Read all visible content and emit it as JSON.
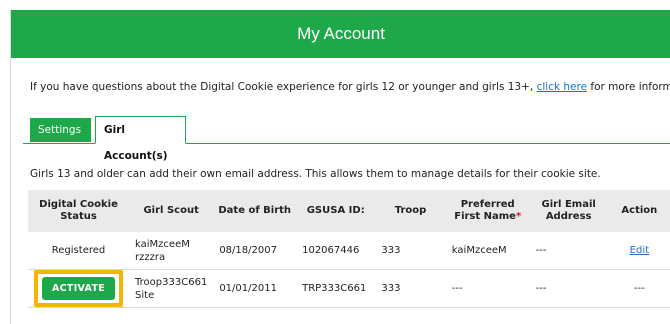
{
  "header": {
    "title": "My Account"
  },
  "info": {
    "text_before": "If you have questions about the Digital Cookie experience for girls 12 or younger and girls 13+, ",
    "link_text": "click here",
    "text_after": " for more information."
  },
  "tabs": [
    {
      "label": "Settings"
    },
    {
      "label": "Girl Account(s)"
    }
  ],
  "note": "Girls 13 and older can add their own email address. This allows them to manage details for their cookie site.",
  "table": {
    "headers": {
      "status": "Digital Cookie Status",
      "girl_scout": "Girl Scout",
      "dob": "Date of Birth",
      "gsusa_id": "GSUSA ID:",
      "troop": "Troop",
      "preferred_name": "Preferred First Name",
      "required_mark": "*",
      "email": "Girl Email Address",
      "action": "Action"
    },
    "rows": [
      {
        "status": "Registered",
        "girl_scout": "kaiMzceeM rzzzra",
        "dob": "08/18/2007",
        "gsusa_id": "102067446",
        "troop": "333",
        "preferred_name": "kaiMzceeM",
        "email": "---",
        "action": "Edit"
      },
      {
        "status": "ACTIVATE",
        "girl_scout": "Troop333C661 Site",
        "dob": "01/01/2011",
        "gsusa_id": "TRP333C661",
        "troop": "333",
        "preferred_name": "---",
        "email": "---",
        "action": "---"
      }
    ]
  },
  "colors": {
    "brand_green": "#1ea84a",
    "highlight": "#f5b400",
    "link": "#1a73c9"
  }
}
